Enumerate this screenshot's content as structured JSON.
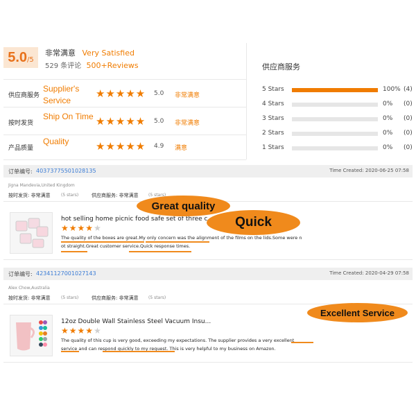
{
  "summary": {
    "score": "5.0",
    "score_suffix": "/5",
    "label_cn": "非常满意",
    "label_en": "Very Satisfied",
    "count_cn": "529 条评论",
    "count_en": "500+Reviews"
  },
  "ratings": [
    {
      "cn": "供应商服务",
      "en": "Supplier's Service",
      "stars": 5,
      "score": "5.0",
      "level": "非常满意"
    },
    {
      "cn": "按时发货",
      "en": "Ship On Time",
      "stars": 5,
      "score": "5.0",
      "level": "非常满意"
    },
    {
      "cn": "产品质量",
      "en": "Quality",
      "stars": 5,
      "score": "4.9",
      "level": "满意"
    }
  ],
  "distribution": {
    "title": "供应商服务",
    "rows": [
      {
        "label": "5 Stars",
        "percent": "100%",
        "count": "(4)",
        "fraction": 1.0
      },
      {
        "label": "4 Stars",
        "percent": "0%",
        "count": "(0)",
        "fraction": 0
      },
      {
        "label": "3 Stars",
        "percent": "0%",
        "count": "(0)",
        "fraction": 0
      },
      {
        "label": "2 Stars",
        "percent": "0%",
        "count": "(0)",
        "fraction": 0
      },
      {
        "label": "1 Stars",
        "percent": "0%",
        "count": "(0)",
        "fraction": 0
      }
    ]
  },
  "orders": [
    {
      "order_label": "订单编号:",
      "order_no": "40373775501028135",
      "time": "Time Created: 2020-06-25 07:58",
      "reviewer": "Jigna Mandevia,United Kingdom",
      "ship_label": "按时发货: 非常满意",
      "ship_stars": "(5 stars)",
      "service_label": "供应商服务: 非常满意",
      "service_stars": "(5 stars)",
      "product_title": "hot selling home picnic food safe set of three c...",
      "product_stars": 4,
      "review_line1": "The quality of the boxes are great.My only concern was the alignment of the films on the lids.Some were n",
      "review_line2": "ot straight.Great customer service.Quick response times."
    },
    {
      "order_label": "订单编号:",
      "order_no": "42341127001027143",
      "time": "Time Created: 2020-04-29 07:58",
      "reviewer": "Alex Chow,Australia",
      "ship_label": "按时发货: 非常满意",
      "ship_stars": "(5 stars)",
      "service_label": "供应商服务: 非常满意",
      "service_stars": "(5 stars)",
      "product_title": "12oz Double Wall Stainless Steel Vacuum Insu...",
      "product_stars": 4,
      "review_line1": "The quality of this cup is very good, exceeding my expectations. The supplier provides a very excellent",
      "review_line2": "service and can respond quickly to my request. This is very helpful to my business on Amazon."
    }
  ],
  "callouts": {
    "great_quality": "Great quality",
    "quick": "Quick",
    "excellent_service": "Excellent Service"
  },
  "colors": {
    "accent": "#f07c00",
    "callout": "#f08a1c",
    "link": "#3a7bd5",
    "header_bg": "#efefef"
  }
}
